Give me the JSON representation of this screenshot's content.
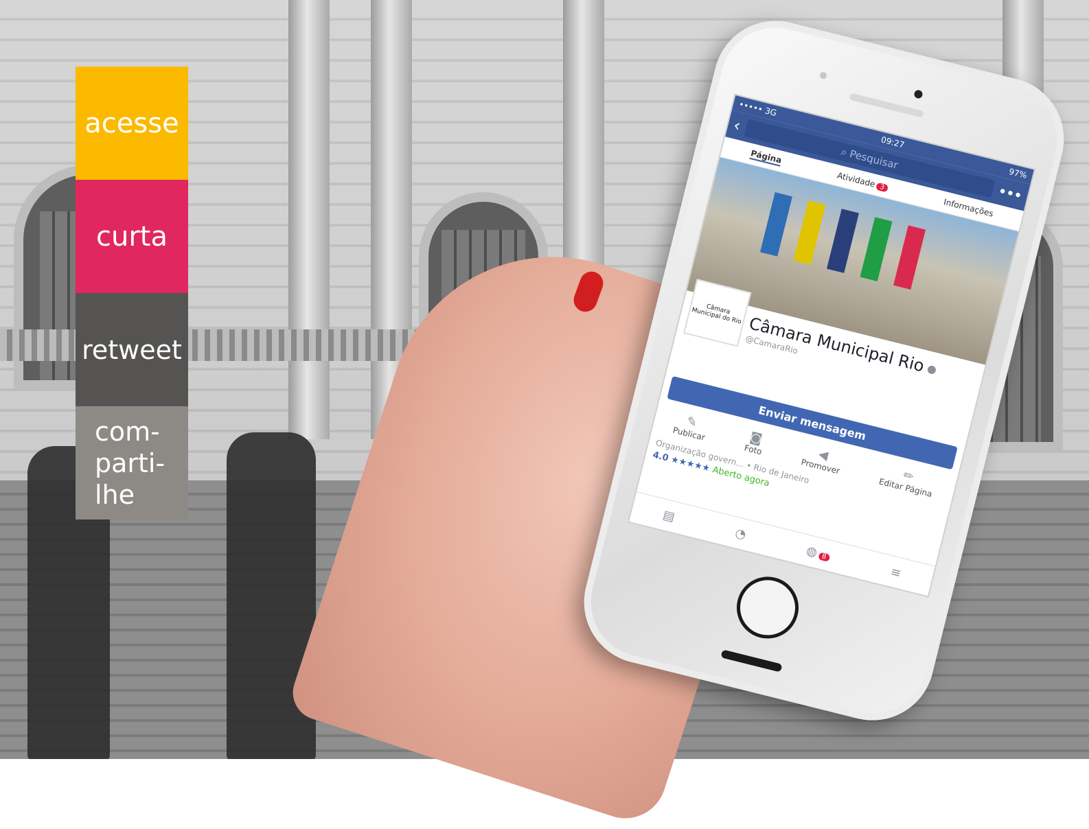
{
  "tags": {
    "acesse": "acesse",
    "curta": "curta",
    "retweet": "retweet",
    "compartilhe_lines": [
      "com-",
      "parti-",
      "lhe"
    ]
  },
  "phone": {
    "status": {
      "carrier_dots": "•••••",
      "network": "3G",
      "time": "09:27",
      "battery": "97%"
    },
    "search_placeholder": "Pesquisar",
    "tabs": [
      {
        "label": "Página"
      },
      {
        "label": "Atividade",
        "badge": "3"
      },
      {
        "label": "Informações"
      }
    ],
    "page_name": "Câmara Municipal Rio",
    "handle": "@CamaraRio",
    "logo_text": "Câmara Municipal do Rio",
    "message_button": "Enviar mensagem",
    "actions": [
      "Publicar",
      "Foto",
      "Promover",
      "Editar Página"
    ],
    "category": "Organização govern...",
    "location": "• Rio de Janeiro",
    "rating": "4.0",
    "stars": "★★★★★",
    "open_status": "Aberto agora",
    "bottom_badge": "8"
  },
  "colors": {
    "acesse": "#fbb900",
    "curta": "#e0275f",
    "retweet": "#555452",
    "compartilhe": "#8d8a86",
    "facebook_blue": "#3b5998"
  }
}
